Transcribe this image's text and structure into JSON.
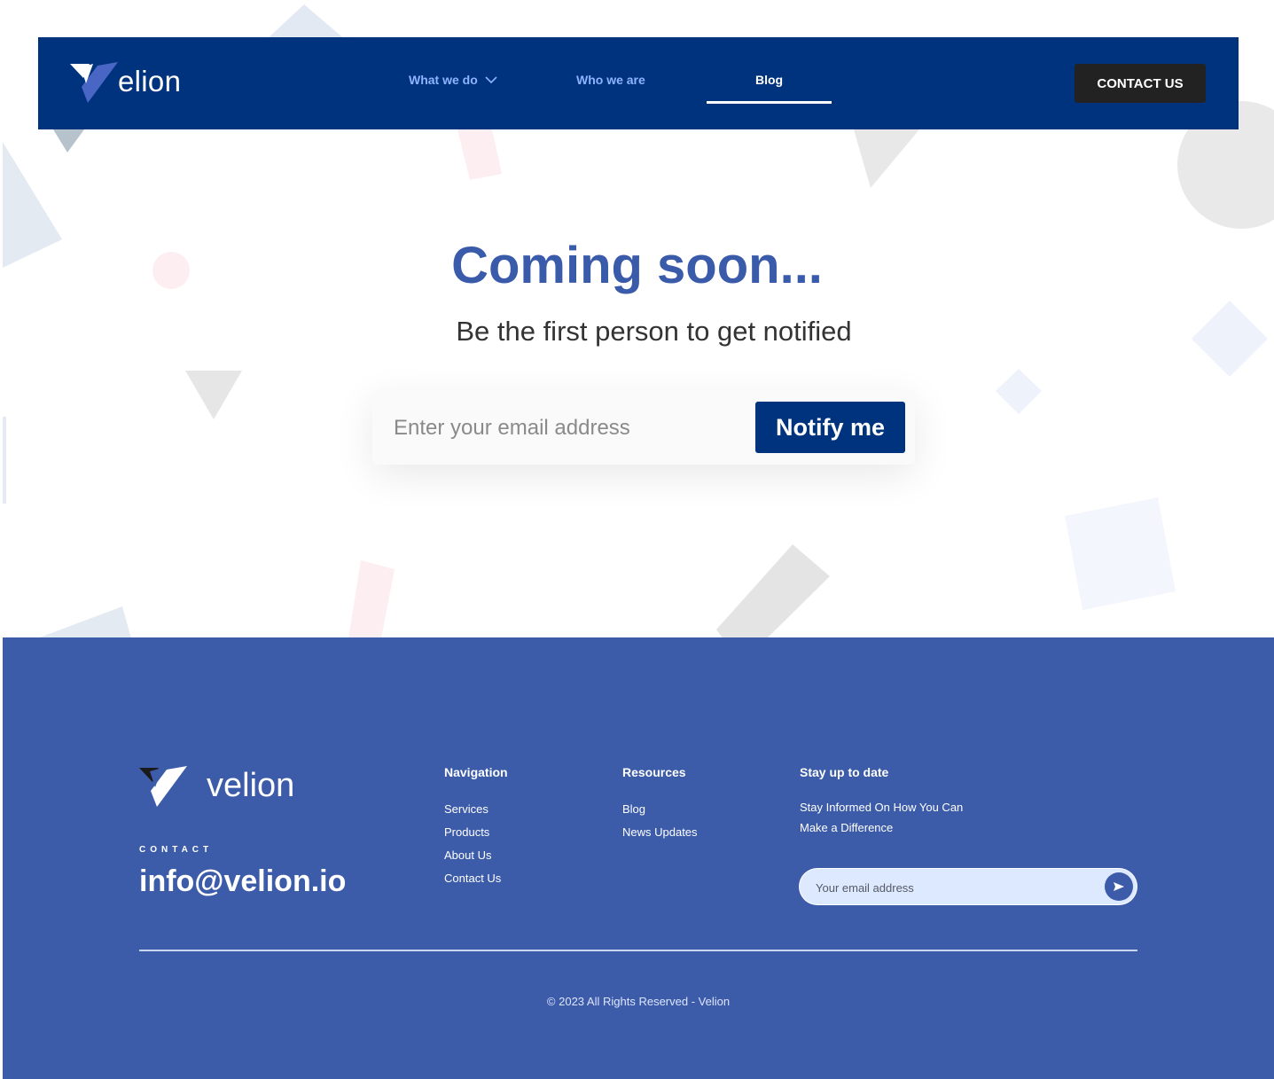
{
  "header": {
    "logo_text": "elion",
    "nav": [
      {
        "label": "What we do"
      },
      {
        "label": "Who we are"
      },
      {
        "label": "Blog"
      }
    ],
    "contact_button": "CONTACT US"
  },
  "hero": {
    "title": "Coming soon...",
    "subtitle": "Be the first person to get notified",
    "email_placeholder": "Enter your email address",
    "notify_button": "Notify me"
  },
  "footer": {
    "logo_text": "velion",
    "contact_label": "CONTACT",
    "contact_email": "info@velion.io",
    "navigation": {
      "title": "Navigation",
      "links": [
        "Services",
        "Products",
        "About Us",
        "Contact Us"
      ]
    },
    "resources": {
      "title": "Resources",
      "links": [
        "Blog",
        "News Updates"
      ]
    },
    "stay": {
      "title": "Stay up to date",
      "text": "Stay Informed On How You Can Make a Difference",
      "email_placeholder": "Your email address"
    },
    "copyright": "© 2023 All Rights Reserved -  Velion"
  },
  "colors": {
    "header_bg": "#00337d",
    "footer_bg": "#3c5ba8",
    "accent": "#3a5aaa",
    "contact_button_bg": "#222222"
  }
}
